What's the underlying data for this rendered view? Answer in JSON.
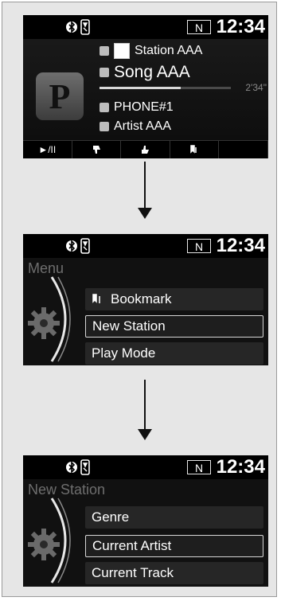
{
  "status": {
    "clock": "12:34",
    "gear": "N"
  },
  "screen1": {
    "station": "Station AAA",
    "song": "Song AAA",
    "elapsed": "2'34\"",
    "progress": 0.62,
    "phone": "PHONE#1",
    "artist": "Artist AAA",
    "logo_letter": "P",
    "controls": [
      "►/II",
      "",
      "",
      "",
      ""
    ]
  },
  "screen2": {
    "title": "Menu",
    "items": [
      {
        "label": "Bookmark",
        "icon": "bookmark-icon"
      },
      {
        "label": "New Station",
        "selected": true
      },
      {
        "label": "Play Mode"
      }
    ]
  },
  "screen3": {
    "title": "New Station",
    "items": [
      {
        "label": "Genre"
      },
      {
        "label": "Current Artist",
        "selected": true
      },
      {
        "label": "Current Track"
      }
    ]
  },
  "colors": {
    "screen_bg": "#111111",
    "title_grey": "#6e6e6e",
    "item_bg": "#262626",
    "frame_bg": "#e6e6e6"
  }
}
